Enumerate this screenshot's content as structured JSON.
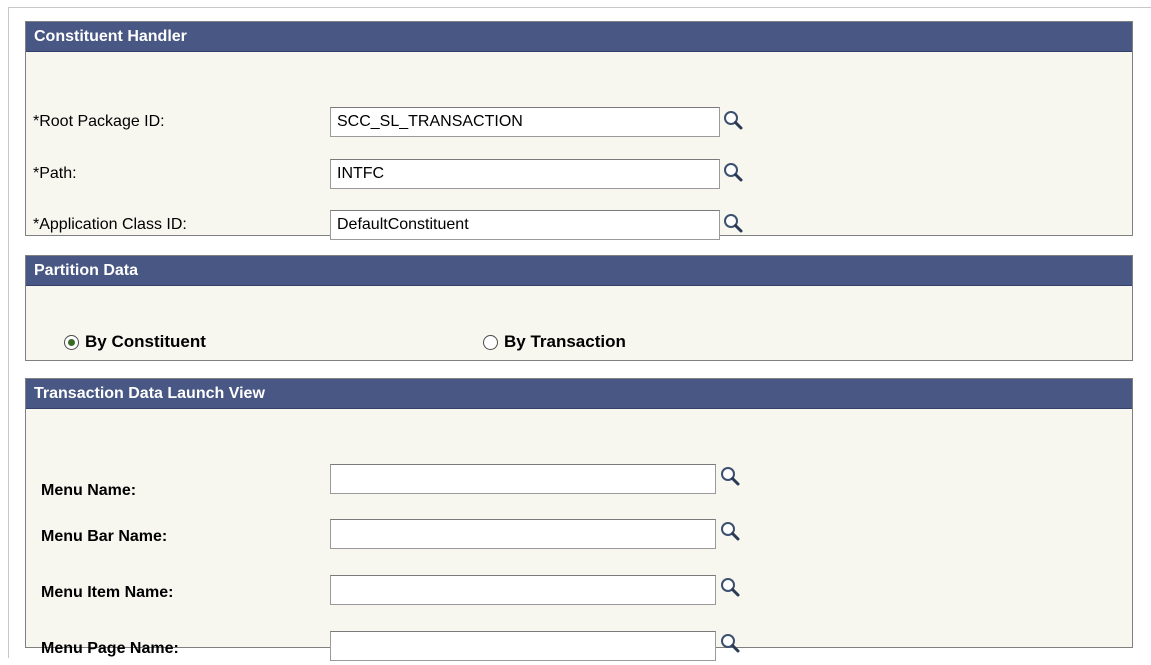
{
  "constituent_handler": {
    "header": "Constituent Handler",
    "root_package": {
      "label": "*Root Package ID:",
      "value": "SCC_SL_TRANSACTION"
    },
    "path": {
      "label": "*Path:",
      "value": "INTFC"
    },
    "app_class": {
      "label": "*Application Class ID:",
      "value": "DefaultConstituent"
    }
  },
  "partition_data": {
    "header": "Partition Data",
    "options": [
      {
        "label": "By Constituent",
        "selected": true
      },
      {
        "label": "By Transaction",
        "selected": false
      }
    ]
  },
  "launch_view": {
    "header": "Transaction Data Launch View",
    "menu_name": {
      "label": "Menu Name:",
      "value": ""
    },
    "menu_bar_name": {
      "label": "Menu Bar Name:",
      "value": ""
    },
    "menu_item_name": {
      "label": "Menu Item Name:",
      "value": ""
    },
    "menu_page_name": {
      "label": "Menu Page Name:",
      "value": ""
    }
  },
  "icons": {
    "lookup": "magnifier-lookup-icon"
  },
  "colors": {
    "header_bg": "#485783",
    "panel_bg": "#f7f7f0",
    "border": "#808080"
  }
}
